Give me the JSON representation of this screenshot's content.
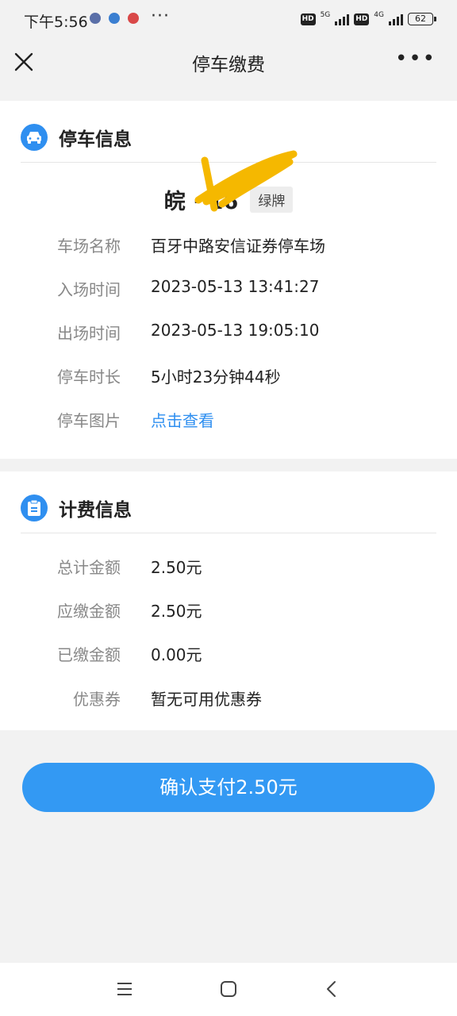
{
  "status_bar": {
    "time": "下午5:56",
    "hd1": "HD",
    "net1": "5G",
    "hd2": "HD",
    "net2": "4G",
    "battery": "62"
  },
  "nav": {
    "title": "停车缴费"
  },
  "parking_info": {
    "title": "停车信息",
    "plate": "皖  ·  16",
    "plate_type": "绿牌",
    "rows": [
      {
        "label": "车场名称",
        "value": "百牙中路安信证券停车场"
      },
      {
        "label": "入场时间",
        "value": "2023-05-13 13:41:27"
      },
      {
        "label": "出场时间",
        "value": "2023-05-13 19:05:10"
      },
      {
        "label": "停车时长",
        "value": "5小时23分钟44秒"
      },
      {
        "label": "停车图片",
        "value": "点击查看"
      }
    ]
  },
  "billing_info": {
    "title": "计费信息",
    "rows": [
      {
        "label": "总计金额",
        "value": "2.50元"
      },
      {
        "label": "应缴金额",
        "value": "2.50元"
      },
      {
        "label": "已缴金额",
        "value": "0.00元"
      },
      {
        "label": "优惠券",
        "value": "暂无可用优惠券"
      }
    ]
  },
  "pay_button": "确认支付2.50元",
  "colors": {
    "accent": "#2f8ff0",
    "button": "#3399f3",
    "scribble": "#f5b800"
  }
}
